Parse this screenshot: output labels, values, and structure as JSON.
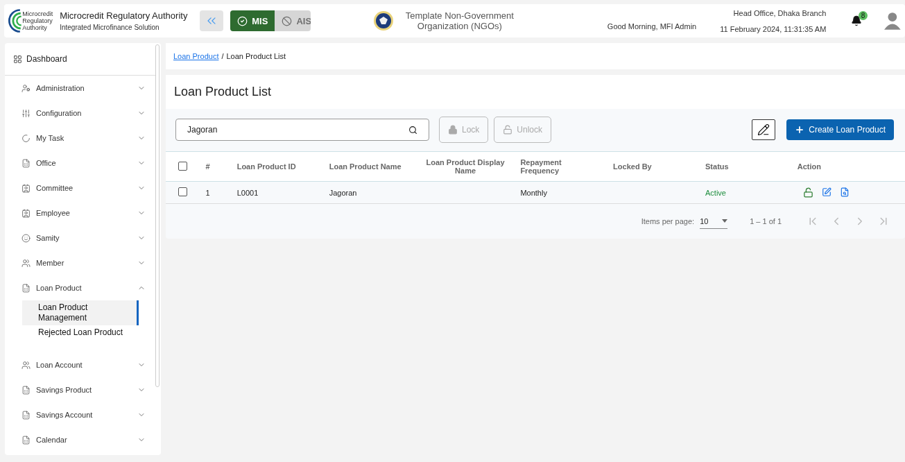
{
  "header": {
    "org_name": "Microcredit Regulatory Authority",
    "org_subtitle": "Integrated Microfinance Solution",
    "logo_text": [
      "Microcredit",
      "Regulatory",
      "Authority"
    ],
    "modules": [
      {
        "label": "MIS",
        "selected": true
      },
      {
        "label": "AIS",
        "selected": false
      }
    ],
    "ngo_name": "Template Non-Government Organization (NGOs)",
    "greeting": "Good Morning, MFI Admin",
    "branch": "Head Office, Dhaka Branch",
    "datetime": "11 February 2024, 11:31:35 AM",
    "notification_count": "8"
  },
  "sidebar": {
    "dashboard": "Dashboard",
    "items": [
      {
        "label": "Administration",
        "expanded": false
      },
      {
        "label": "Configuration",
        "expanded": false
      },
      {
        "label": "My Task",
        "expanded": false
      },
      {
        "label": "Office",
        "expanded": false
      },
      {
        "label": "Committee",
        "expanded": false
      },
      {
        "label": "Employee",
        "expanded": false
      },
      {
        "label": "Samity",
        "expanded": false
      },
      {
        "label": "Member",
        "expanded": false
      },
      {
        "label": "Loan Product",
        "expanded": true,
        "children": [
          {
            "label": "Loan Product Management",
            "selected": true
          },
          {
            "label": "Rejected Loan Product",
            "selected": false
          }
        ]
      },
      {
        "label": "Loan Account",
        "expanded": false
      },
      {
        "label": "Savings Product",
        "expanded": false
      },
      {
        "label": "Savings Account",
        "expanded": false
      },
      {
        "label": "Calendar",
        "expanded": false
      }
    ]
  },
  "breadcrumb_separator": "/",
  "breadcrumb": [
    {
      "label": "Loan Product",
      "kind": "link"
    },
    {
      "label": "Loan Product List",
      "kind": "current"
    }
  ],
  "title": "Loan Product List",
  "search": {
    "value": "Jagoran"
  },
  "actions": [
    {
      "label": "Lock",
      "kind": "lock",
      "disabled": true
    },
    {
      "label": "Unlock",
      "kind": "unlock",
      "disabled": true
    }
  ],
  "create_button": "Create Loan Product",
  "table": {
    "header_checked": false,
    "columns": [
      "#",
      "Loan Product ID",
      "Loan Product Name",
      "Loan Product Display Name",
      "Repayment Frequency",
      "Locked By",
      "Status",
      "Action"
    ],
    "rows": [
      {
        "checked": false,
        "cells": [
          "1",
          "L0001",
          "Jagoran",
          "",
          "Monthly",
          ""
        ],
        "status": "Active",
        "locked": false
      }
    ]
  },
  "pagination": {
    "label": "Items per page:",
    "page_size": "10",
    "range": "1 – 1 of 1"
  }
}
